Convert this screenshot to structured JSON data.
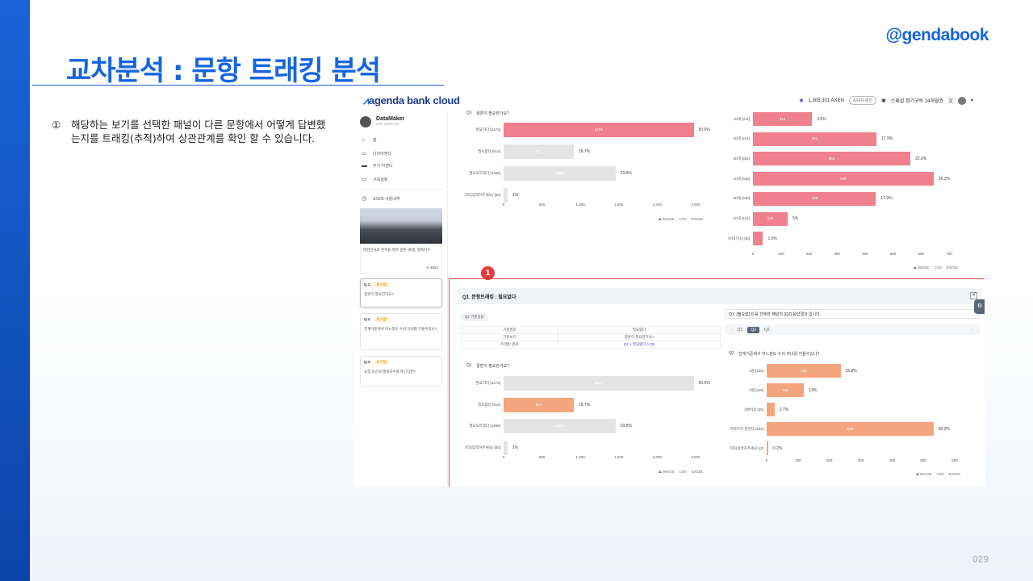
{
  "brand": "@gendabook",
  "slide_title": "교차분석 : 문항 트래킹 분석",
  "description": {
    "num": "①",
    "text": "해당하는 보기를 선택한 패널이 다른 문항에서 어떻게 답변했는지를 트래킹(추적)하여 상관관계를 확인 할 수 있습니다."
  },
  "page_number": "029",
  "callout_badge": "1",
  "app": {
    "logo_prefix": "agenda",
    "logo_suffix": " bank cloud",
    "axen_balance": "1,305,301 AXEN",
    "axen_charge": "AXEN 충전",
    "subscription": "스페셜 정기구독 24개월권",
    "user_name": "DataMaker",
    "user_sub": "INFLUENCER",
    "nav": [
      "홈",
      "나의아젠다",
      "추가 아젠다",
      "구독설정",
      "AXEN 사용내역"
    ],
    "photo_caption": "대한민국의 존속을 위한 결혼, 출생, 행복지수",
    "photo_views": "4654",
    "questions": [
      {
        "num": "Q.1.",
        "tag": "보기형",
        "text": "결혼이 필요한가요?"
      },
      {
        "num": "Q.2.",
        "tag": "보기형",
        "text": "한계기준에서 어느정도 수의 자녀를 키울수있나?"
      },
      {
        "num": "Q.3.",
        "tag": "보기형",
        "text": "요즘 당신의 행복지수를 매긴다면?"
      }
    ],
    "export": [
      "IMAGE",
      "CSV",
      "EXCEL"
    ],
    "q1_title": "결혼이 필요한가요?",
    "modal_title": "Q1. 문항트래킹 : 필요없다",
    "modal_chip": "Q1 기준응답",
    "modal_table": [
      [
        "기준질문",
        "필요없다"
      ],
      [
        "기준보기",
        "결혼이 필요한가요?"
      ],
      [
        "트래킹 경로",
        "Q1 > 필요없다 > Q2"
      ]
    ],
    "modal_info": "Q1. [필요없다] 를 선택한 패널의 [Q2] 응답결과 입니다.",
    "modal_tabs": [
      "Q1",
      "Q2",
      "Q3"
    ],
    "modal_q2_title": "한계기준에서 어느정도 수의 자녀를 키울수있나?"
  },
  "chart_data": [
    {
      "type": "bar",
      "title": "결혼이 필요한가요?",
      "categories": [
        "필요하다 [2474]",
        "필요없다 [914]",
        "필요모르겠다 [1456]",
        "기타(입력하주세요) [50]"
      ],
      "values": [
        2474,
        914,
        1456,
        50
      ],
      "labels": [
        "50.6%",
        "18.7%",
        "29.8%",
        "1%"
      ],
      "xticks": [
        "0",
        "500",
        "1,000",
        "1,500",
        "2,000",
        "2,500"
      ],
      "xlim": [
        0,
        2500
      ]
    },
    {
      "type": "bar",
      "categories": [
        "10대 [211]",
        "20대 [441]",
        "30대 [562]",
        "40대 [645]",
        "50대 [439]",
        "60대 [124]",
        "70대 이상 [36]"
      ],
      "values": [
        211,
        441,
        562,
        645,
        439,
        124,
        36
      ],
      "labels": [
        "3.6%",
        "17.9%",
        "22.9%",
        "26.2%",
        "17.9%",
        "5%",
        "1.5%"
      ],
      "xticks": [
        "0",
        "100",
        "200",
        "300",
        "400",
        "500",
        "600",
        "700"
      ],
      "xlim": [
        0,
        700
      ]
    },
    {
      "type": "bar",
      "title": "결혼이 필요한가요?",
      "categories": [
        "필요하다 [2474]",
        "필요없다 [914]",
        "필요모르겠다 [1456]",
        "기타(입력하주세요) [50]"
      ],
      "values": [
        2474,
        914,
        1456,
        50
      ],
      "labels": [
        "50.6%",
        "18.7%",
        "29.8%",
        "1%"
      ],
      "highlight": 1,
      "xticks": [
        "0",
        "500",
        "1,000",
        "1,500",
        "2,000",
        "2,500"
      ],
      "xlim": [
        0,
        2500
      ]
    },
    {
      "type": "bar",
      "title": "한계기준에서 어느정도 수의 자녀를 키울수있나?",
      "categories": [
        "1명 [236]",
        "2명 [119]",
        "3명이상 [25]",
        "키워지지 못한다 [532]",
        "기타(입력하주세요) [2]"
      ],
      "values": [
        236,
        119,
        25,
        532,
        2
      ],
      "labels": [
        "25.8%",
        "13%",
        "2.7%",
        "58.2%",
        "0.2%"
      ],
      "xticks": [
        "0",
        "100",
        "200",
        "300",
        "400",
        "500",
        "600"
      ],
      "xlim": [
        0,
        600
      ]
    }
  ],
  "colors": {
    "accent": "#1565e0",
    "pink": "#f0808d",
    "grey": "#e4e4e4",
    "orange": "#f5a57e",
    "highlight_box": "#e84a4a"
  }
}
